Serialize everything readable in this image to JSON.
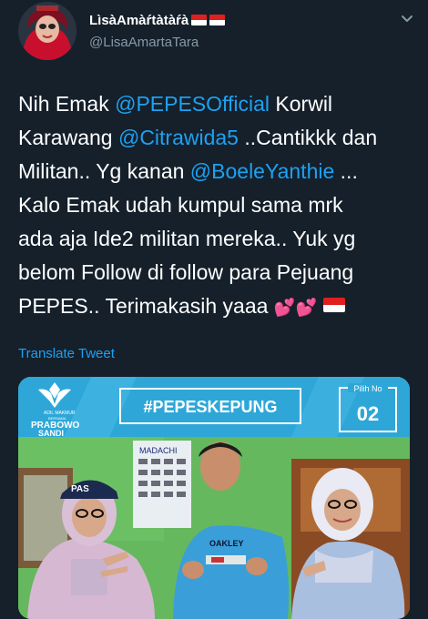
{
  "user": {
    "display_name": "LìsàAmàŕtàtàŕà",
    "handle": "@LisaAmartaTara",
    "flags": "indonesia-flag"
  },
  "tweet": {
    "lines": [
      [
        {
          "t": "Nih Emak "
        },
        {
          "t": "@PEPESOfficial",
          "m": true
        },
        {
          "t": " Korwil"
        }
      ],
      [
        {
          "t": "Karawang "
        },
        {
          "t": "@Citrawida5",
          "m": true
        },
        {
          "t": " ..Cantikkk dan"
        }
      ],
      [
        {
          "t": "Militan.. Yg kanan "
        },
        {
          "t": "@BoeleYanthie",
          "m": true
        },
        {
          "t": " ..."
        }
      ],
      [
        {
          "t": "Kalo Emak udah kumpul sama mrk"
        }
      ],
      [
        {
          "t": "ada aja Ide2 militan mereka.. Yuk yg"
        }
      ],
      [
        {
          "t": "belom Follow di follow para Pejuang"
        }
      ],
      [
        {
          "t": "PEPES..  Terimakasih yaaa "
        }
      ]
    ],
    "emoji_end": [
      "two-hearts-icon",
      "two-hearts-icon",
      "indonesia-flag"
    ]
  },
  "translate_label": "Translate Tweet",
  "media": {
    "banner_text_1": "ADIL MAKMUR",
    "banner_text_2": "BERSAMA",
    "banner_text_3": "PRABOWO",
    "banner_text_4": "SANDI",
    "hashtag": "#PEPESKEPUNG",
    "pilih_label": "Pilih No",
    "number": "02",
    "cap_text": "PAS",
    "shirt_text": "OAKLEY",
    "poster_text": "MADACHI"
  },
  "colors": {
    "background": "#15202b",
    "accent": "#1da1f2",
    "secondary_text": "#8899a6",
    "banner_blue": "#2ea7d8",
    "banner_navy": "#13395f"
  }
}
